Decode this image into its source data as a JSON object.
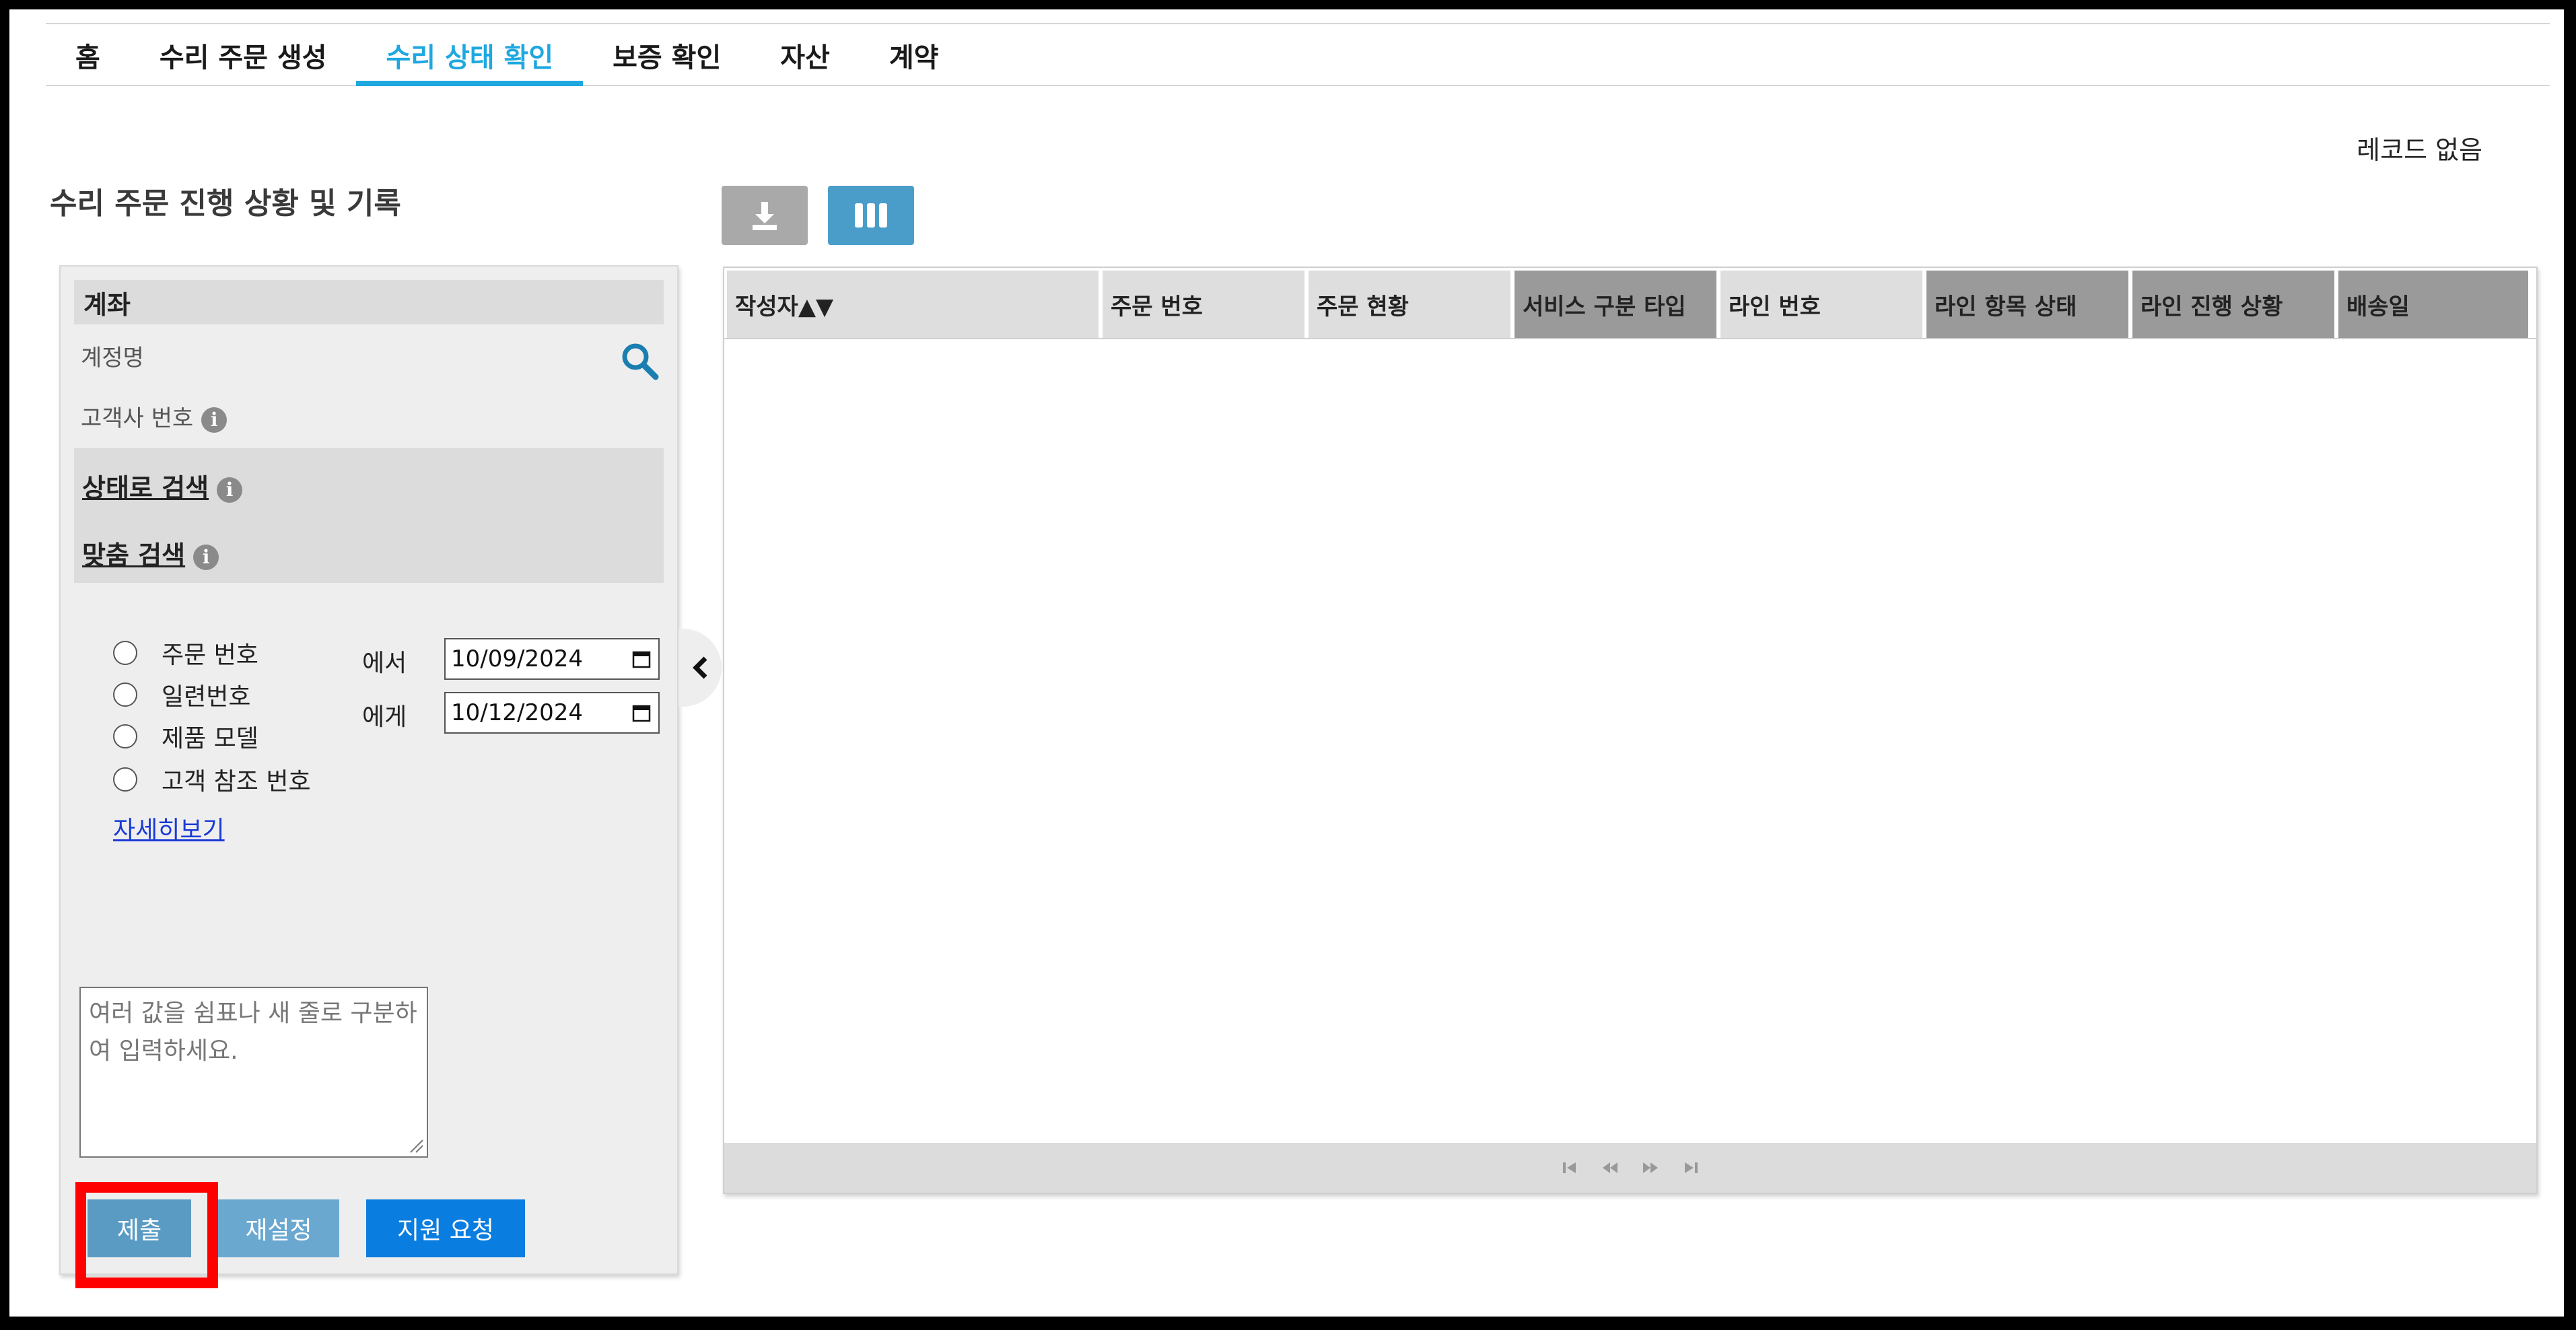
{
  "nav": {
    "tabs": [
      {
        "label": "홈"
      },
      {
        "label": "수리 주문 생성"
      },
      {
        "label": "수리 상태 확인"
      },
      {
        "label": "보증 확인"
      },
      {
        "label": "자산"
      },
      {
        "label": "계약"
      }
    ],
    "active_tab": "수리 상태 확인"
  },
  "page": {
    "title": "수리 주문 진행 상황 및 기록",
    "records_status": "레코드 없음"
  },
  "toolbar": {
    "download_icon": "download-icon",
    "columns_icon": "columns-icon"
  },
  "filter": {
    "account_header": "계좌",
    "account_name_label": "계정명",
    "customer_number_label": "고객사 번호",
    "search_by_status": "상태로 검색",
    "custom_search": "맞춤 검색",
    "radio_options": [
      {
        "label": "주문 번호"
      },
      {
        "label": "일련번호"
      },
      {
        "label": "제품 모델"
      },
      {
        "label": "고객 참조 번호"
      }
    ],
    "more_link": "자세히보기",
    "from_label": "에서",
    "to_label": "에게",
    "from_date": "10/09/2024",
    "to_date": "10/12/2024",
    "textarea_placeholder": "여러 값을 쉼표나 새 줄로 구분하여 입력하세요.",
    "submit_label": "제출",
    "reset_label": "재설정",
    "support_label": "지원 요청"
  },
  "grid": {
    "columns": [
      {
        "label": "작성자▲▼"
      },
      {
        "label": "주문 번호"
      },
      {
        "label": "주문 현황"
      },
      {
        "label": "서비스 구분 타입"
      },
      {
        "label": "라인 번호"
      },
      {
        "label": "라인 항목 상태"
      },
      {
        "label": "라인 진행 상황"
      },
      {
        "label": "배송일"
      }
    ]
  },
  "colors": {
    "accent": "#1fa8e0",
    "submit": "#5a9bc4",
    "support": "#0a7de0",
    "highlight": "#ff0000"
  }
}
